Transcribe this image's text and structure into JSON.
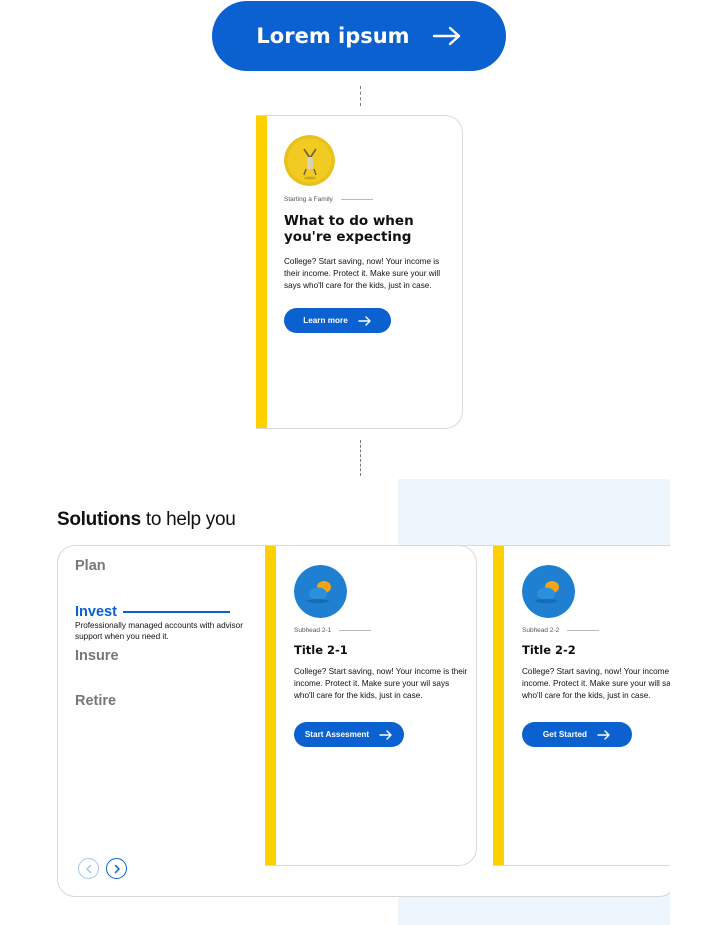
{
  "hero_button": {
    "label": "Lorem ipsum",
    "icon": "arrow-right-icon"
  },
  "featured_card": {
    "eyebrow": "Starting a Family",
    "title": "What to do when you're expecting",
    "body": "College? Start saving, now! Your income is their income. Protect it. Make sure your will says who'll care for the kids, just in case.",
    "button_label": "Learn more"
  },
  "solutions": {
    "heading_bold": "Solutions",
    "heading_rest": " to help you",
    "tabs": [
      {
        "label": "Plan"
      },
      {
        "label": "Invest",
        "description": "Professionally managed accounts with advisor support when you need it."
      },
      {
        "label": "Insure"
      },
      {
        "label": "Retire"
      }
    ],
    "cards": [
      {
        "eyebrow": "Subhead 2-1",
        "title": "Title 2-1",
        "body": "College? Start saving, now! Your income is their income. Protect it. Make sure your wil says who'll care for the kids, just in case.",
        "button_label": "Start Assesment"
      },
      {
        "eyebrow": "Subhead 2-2",
        "title": "Title 2-2",
        "body": "College? Start saving, now! Your income is their income. Protect it. Make sure your will says who'll care for the kids, just in case.",
        "button_label": "Get Started"
      }
    ]
  },
  "colors": {
    "primary": "#0a61cf",
    "accent_stripe": "#ffd000",
    "panel_bg": "#edf5fd"
  }
}
